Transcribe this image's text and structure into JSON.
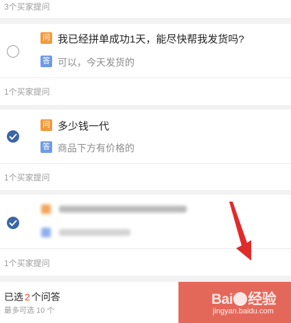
{
  "top_strip": {
    "count_text": "3个买家提问"
  },
  "questions": [
    {
      "question_badge": "问",
      "answer_badge": "答",
      "question": "我已经拼单成功1天，能尽快帮我发货吗?",
      "answer": "可以，今天发货的",
      "count_text": "1个买家提问",
      "selected": false
    },
    {
      "question_badge": "问",
      "answer_badge": "答",
      "question": "多少钱一代",
      "answer": "商品下方有价格的",
      "count_text": "1个买家提问",
      "selected": true
    },
    {
      "question_badge": "问",
      "answer_badge": "答",
      "question": "",
      "answer": "",
      "count_text": "1个买家提问",
      "selected": true,
      "blurred": true
    }
  ],
  "footer": {
    "selected_prefix": "已选",
    "selected_count": "2",
    "selected_suffix": "个问答",
    "max_text": "最多可选 10 个"
  },
  "watermark": {
    "logo_text": "Bai",
    "logo_text_2": "经验",
    "site": "jingyan.baidu.com"
  },
  "colors": {
    "accent_blue": "#3a66a8",
    "question_orange": "#f29a3a",
    "answer_blue": "#6f9be6",
    "count_red": "#e4432b",
    "arrow_red": "#e02b2b"
  }
}
